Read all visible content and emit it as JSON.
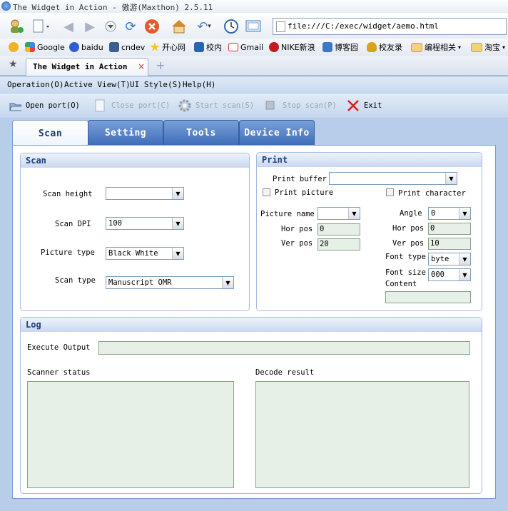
{
  "window": {
    "title": "The Widget in Action - 傲游(Maxthon) 2.5.11"
  },
  "address": {
    "url": "file:///C:/exec/widget/aemo.html"
  },
  "bookmarks": [
    {
      "label": ""
    },
    {
      "label": "Google"
    },
    {
      "label": "baidu"
    },
    {
      "label": "cndev"
    },
    {
      "label": "开心网"
    },
    {
      "label": "校内"
    },
    {
      "label": "Gmail"
    },
    {
      "label": "NIKE新浪"
    },
    {
      "label": "博客园"
    },
    {
      "label": "校友录"
    },
    {
      "label": "编程相关"
    },
    {
      "label": "淘宝"
    }
  ],
  "browser_tab": {
    "label": "The Widget in Action",
    "close": "×",
    "new_tab": "+"
  },
  "menu": [
    "Operation(O)",
    "Active View(T)",
    "UI Style(S)",
    "Help(H)"
  ],
  "toolbar": {
    "open": "Open port(O)",
    "close": "Close port(C)",
    "start": "Start scan(S)",
    "stop": "Stop scan(P)",
    "exit": "Exit"
  },
  "tabs": [
    "Scan",
    "Setting",
    "Tools",
    "Device Info"
  ],
  "scan": {
    "title": "Scan",
    "height_label": "Scan height",
    "height_value": "",
    "dpi_label": "Scan DPI",
    "dpi_value": "100",
    "picture_type_label": "Picture type",
    "picture_type_value": "Black White",
    "scan_type_label": "Scan type",
    "scan_type_value": "Manuscript OMR"
  },
  "print": {
    "title": "Print",
    "buffer_label": "Print buffer",
    "buffer_value": "",
    "print_picture_label": "Print picture",
    "print_character_label": "Print character",
    "picture_name_label": "Picture name",
    "picture_name_value": "",
    "hor_pos_label": "Hor pos",
    "hor_pos_value": "0",
    "ver_pos_label": "Ver pos",
    "ver_pos_value": "20",
    "angle_label": "Angle",
    "angle_value": "0",
    "char_hor_pos_label": "Hor pos",
    "char_hor_pos_value": "0",
    "char_ver_pos_label": "Ver pos",
    "char_ver_pos_value": "10",
    "font_type_label": "Font type",
    "font_type_value": "byte",
    "font_size_label": "Font size",
    "font_size_value": "000",
    "content_label": "Content",
    "content_value": ""
  },
  "log": {
    "title": "Log",
    "execute_output_label": "Execute Output",
    "execute_output_value": "",
    "scanner_status_label": "Scanner status",
    "decode_result_label": "Decode result"
  },
  "colors": {
    "accent": "#3d6cb8",
    "panel": "#b8cdea",
    "field": "#e6f0e6"
  }
}
